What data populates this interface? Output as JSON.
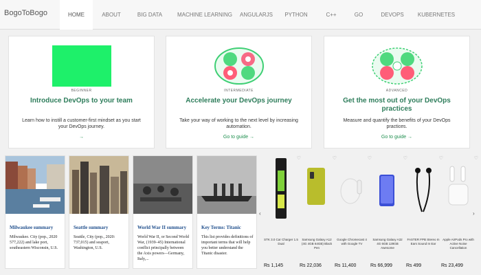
{
  "nav": {
    "brand": "BogoToBogo",
    "items": [
      "HOME",
      "ABOUT",
      "BIG DATA",
      "MACHINE LEARNING",
      "ANGULARJS",
      "PYTHON",
      "C++",
      "GO",
      "DEVOPS",
      "KUBERNETES"
    ]
  },
  "cards": [
    {
      "level": "BEGINNER",
      "title": "Introduce DevOps to your team",
      "desc": "Learn how to instill a customer-first mindset as you start your DevOps journey.",
      "guide": "→"
    },
    {
      "level": "INTERMEDIATE",
      "title": "Accelerate your DevOps journey",
      "desc": "Take your way of working to the next level by increasing automation.",
      "guide": "Go to guide →"
    },
    {
      "level": "ADVANCED",
      "title": "Get the most out of your DevOps practices",
      "desc": "Measure and quantify the benefits of your DevOps practices.",
      "guide": "Go to guide →"
    }
  ],
  "news": [
    {
      "title": "Milwaukee summary",
      "desc": "Milwaukee. City (pop., 2020 577,222) and lake port, southeastern Wisconsin, U.S."
    },
    {
      "title": "Seattle summary",
      "desc": "Seattle, City (pop., 2020: 737,015) and seaport, Washington, U.S."
    },
    {
      "title": "World War II summary",
      "desc": "World War II, or Second World War, (1939–45) International conflict principally between the Axis powers—Germany, Italy,..."
    },
    {
      "title": "Key Terms: Titanic",
      "desc": "This list provides definitions of important terms that will help you better understand the Titanic disaster."
    }
  ],
  "products": [
    {
      "name": "STK 3.0 Car Charger 1.5 Dual",
      "price": "Rs 1,145"
    },
    {
      "name": "Samsung Galaxy A12 (4G 4GB 64GB) Black Pen",
      "price": "Rs 22,036"
    },
    {
      "name": "Google Chromecast 4 with Google TV",
      "price": "Rs 11,400"
    },
    {
      "name": "Samsung Galaxy A32 4G 6GB 128GB Awesome",
      "price": "Rs 66,999"
    },
    {
      "name": "FASTER FPB Stereo In Ears Sound In Ear",
      "price": "Rs 499"
    },
    {
      "name": "Apple AirPods Pro with Active Noise Cancellation",
      "price": "Rs 23,499"
    }
  ],
  "colors": {
    "accent": "#2e7d5b",
    "link": "#1e8f4e",
    "newsTitle": "#1f4e8c"
  }
}
